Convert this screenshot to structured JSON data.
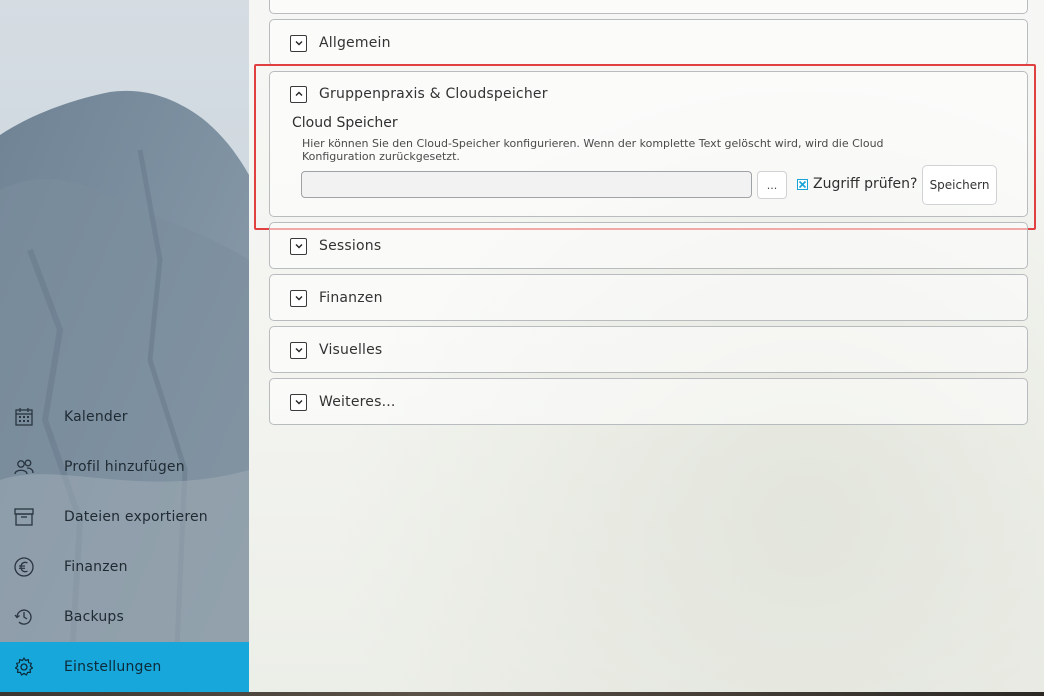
{
  "sidebar": {
    "items": [
      {
        "label": "Kalender",
        "icon": "calendar-icon"
      },
      {
        "label": "Profil hinzufügen",
        "icon": "users-icon"
      },
      {
        "label": "Dateien exportieren",
        "icon": "archive-icon"
      },
      {
        "label": "Finanzen",
        "icon": "euro-icon"
      },
      {
        "label": "Backups",
        "icon": "history-icon"
      },
      {
        "label": "Einstellungen",
        "icon": "gear-icon"
      }
    ],
    "active_index": 5,
    "active_color": "#17a7db"
  },
  "accordion": {
    "allgemein": "Allgemein",
    "gruppenpraxis": "Gruppenpraxis & Cloudspeicher",
    "sessions": "Sessions",
    "finanzen": "Finanzen",
    "visuelles": "Visuelles",
    "weiteres": "Weiteres..."
  },
  "cloud": {
    "title": "Cloud Speicher",
    "description": "Hier können Sie den Cloud-Speicher konfigurieren. Wenn der komplette Text gelöscht wird, wird die Cloud Konfiguration zurückgesetzt.",
    "input_value": "",
    "browse_label": "...",
    "check_label": "Zugriff prüfen?",
    "check_checked": true,
    "save_label": "Speichern"
  },
  "highlight_color": "#e0403f"
}
